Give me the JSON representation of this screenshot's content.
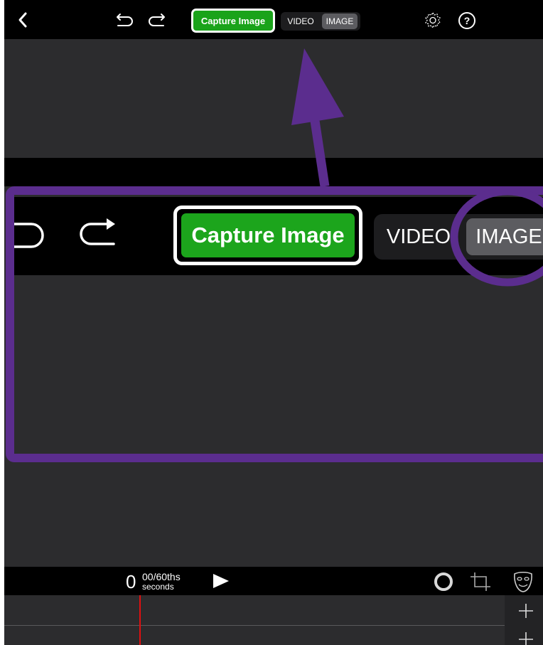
{
  "toolbar": {
    "back_icon": "chevron-left-icon",
    "undo_icon": "undo-icon",
    "redo_icon": "redo-icon",
    "capture_label": "Capture Image",
    "mode_options": [
      "VIDEO",
      "IMAGE"
    ],
    "mode_selected": "IMAGE",
    "settings_icon": "gear-icon",
    "help_icon": "help-icon"
  },
  "zoom_callout": {
    "capture_label": "Capture Image",
    "mode_options": [
      "VIDEO",
      "IMAGE"
    ],
    "mode_selected": "IMAGE"
  },
  "annotation": {
    "color": "#5b2d8e"
  },
  "transport": {
    "time_value": "0",
    "time_fraction": "00/60ths",
    "time_unit": "seconds",
    "play_icon": "play-icon",
    "record_icon": "circle-icon",
    "crop_icon": "crop-icon",
    "mask_icon": "mask-icon"
  },
  "timeline": {
    "add_icon": "plus-icon",
    "playhead_color": "#e01010"
  }
}
